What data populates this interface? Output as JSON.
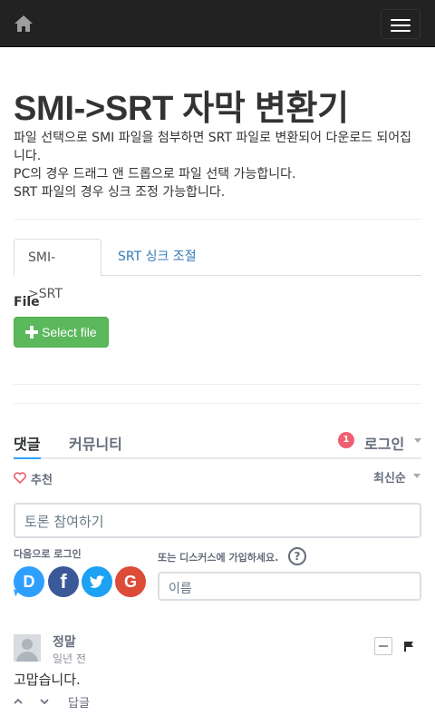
{
  "navbar": {
    "home_icon": "home-icon",
    "toggle_icon": "hamburger-icon"
  },
  "header": {
    "title": "SMI->SRT 자막 변환기",
    "description": [
      "파일 선택으로 SMI 파일을 첨부하면 SRT 파일로 변환되어 다운로드 되어집니다.",
      "PC의 경우 드래그 앤 드롭으로 파일 선택 가능합니다.",
      "SRT 파일의 경우 싱크 조정 가능합니다."
    ]
  },
  "tabs": [
    {
      "label": "SMI->SRT",
      "active": true
    },
    {
      "label": "SRT 싱크 조절",
      "active": false
    }
  ],
  "file": {
    "label": "File",
    "button_label": "Select file",
    "button_icon": "plus-icon"
  },
  "disqus": {
    "tabs": {
      "comments": "댓글",
      "community": "커뮤니티"
    },
    "notification_count": "1",
    "login_label": "로그인",
    "recommend_label": "추천",
    "sort_label": "최신순",
    "comment_placeholder": "토론 참여하기",
    "login_with_label": "다음으로 로그인",
    "signup_label": "또는 디스커스에 가입하세요.",
    "help_label": "?",
    "name_placeholder": "이름",
    "social": [
      {
        "name": "disqus",
        "letter": "D",
        "color": "#2e9fff"
      },
      {
        "name": "facebook",
        "letter": "f",
        "color": "#3b5998"
      },
      {
        "name": "twitter",
        "letter": "t",
        "color": "#1da1f2"
      },
      {
        "name": "google",
        "letter": "G",
        "color": "#dd4b39"
      }
    ],
    "comment": {
      "author": "정말",
      "time": "일년 전",
      "text": "고맙습니다.",
      "reply_label": "답글"
    }
  },
  "colors": {
    "navbar": "#222222",
    "success": "#5cb85c",
    "link": "#337ab7",
    "disqus_blue": "#2e9fff",
    "badge": "#f05f70"
  }
}
